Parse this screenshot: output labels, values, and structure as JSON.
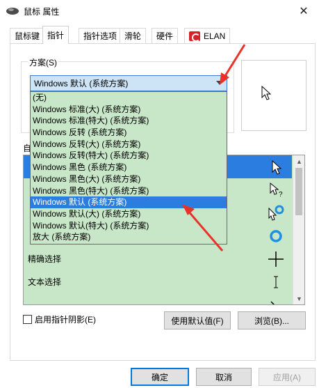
{
  "window": {
    "title": "鼠标 属性",
    "close_glyph": "✕"
  },
  "tabs": [
    {
      "label": "鼠标键",
      "active": false
    },
    {
      "label": "指针",
      "active": true
    },
    {
      "label": "指针选项",
      "active": false
    },
    {
      "label": "滑轮",
      "active": false
    },
    {
      "label": "硬件",
      "active": false
    },
    {
      "label": "ELAN",
      "active": false,
      "icon": "elan-logo-icon"
    }
  ],
  "scheme": {
    "group_label": "方案(S)",
    "selected_value": "Windows 默认 (系统方案)",
    "options": [
      "(无)",
      "Windows 标准(大) (系统方案)",
      "Windows 标准(特大) (系统方案)",
      "Windows 反转 (系统方案)",
      "Windows 反转(大) (系统方案)",
      "Windows 反转(特大) (系统方案)",
      "Windows 黑色 (系统方案)",
      "Windows 黑色(大) (系统方案)",
      "Windows 黑色(特大) (系统方案)",
      "Windows 默认 (系统方案)",
      "Windows 默认(大) (系统方案)",
      "Windows 默认(特大) (系统方案)",
      "放大 (系统方案)"
    ],
    "highlighted_index": 9
  },
  "customize": {
    "label": "自",
    "rows": [
      {
        "label": "",
        "icon": "arrow-pointer-icon",
        "selected": true
      },
      {
        "label": "",
        "icon": "help-select-icon",
        "selected": false
      },
      {
        "label": "",
        "icon": "working-in-background-icon",
        "selected": false
      },
      {
        "label": "",
        "icon": "busy-icon",
        "selected": false
      },
      {
        "label": "精确选择",
        "icon": "precision-select-icon",
        "selected": false
      },
      {
        "label": "文本选择",
        "icon": "text-select-icon",
        "selected": false
      },
      {
        "label": "",
        "icon": "handwriting-icon",
        "selected": false
      }
    ]
  },
  "shadow_checkbox": {
    "label": "启用指针阴影(E)",
    "checked": false
  },
  "buttons": {
    "use_default": "使用默认值(F)",
    "browse": "浏览(B)...",
    "ok": "确定",
    "cancel": "取消",
    "apply": "应用(A)"
  },
  "colors": {
    "accent": "#2b7de0",
    "list_background": "#c8e6c8",
    "annotation_arrow": "#e8332a"
  }
}
